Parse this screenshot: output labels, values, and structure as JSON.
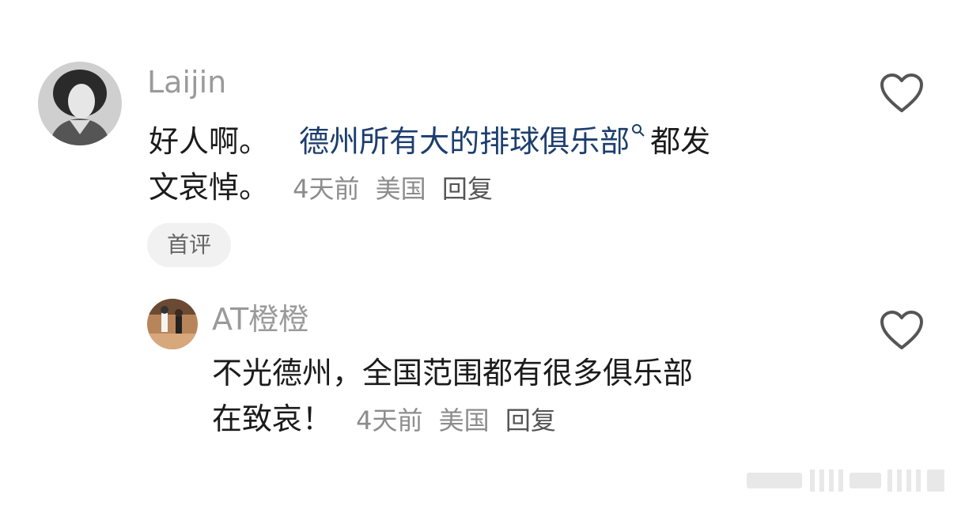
{
  "comments": [
    {
      "username": "Laijin",
      "text_before": "好人啊。",
      "link_text": "德州所有大的排球俱乐部",
      "text_after": "都发",
      "line2": "文哀悼。",
      "time": "4天前",
      "location": "美国",
      "reply_label": "回复",
      "badge": "首评"
    },
    {
      "username": "AT橙橙",
      "line1": "不光德州，全国范围都有很多俱乐部",
      "line2": "在致哀！",
      "time": "4天前",
      "location": "美国",
      "reply_label": "回复"
    }
  ],
  "colors": {
    "link": "#1c3e6e",
    "username": "#9a9a9a",
    "meta": "#8c8c8c",
    "badge_bg": "#f1f1f1"
  },
  "icons": [
    "search-icon",
    "heart-icon"
  ]
}
